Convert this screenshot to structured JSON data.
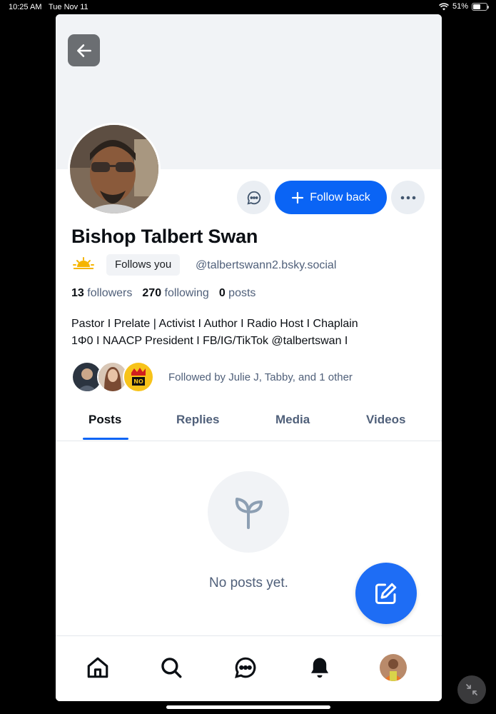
{
  "status_bar": {
    "time": "10:25 AM",
    "date": "Tue Nov 11",
    "battery": "51%"
  },
  "profile": {
    "display_name": "Bishop Talbert Swan",
    "follows_you": "Follows you",
    "handle": "@talbertswann2.bsky.social",
    "followers_count": "13",
    "followers_label": "followers",
    "following_count": "270",
    "following_label": "following",
    "posts_count": "0",
    "posts_label": "posts",
    "bio_line1": "Pastor I Prelate | Activist I Author I Radio Host I Chaplain",
    "bio_line2": "1Φ0 I NAACP President I FB/IG/TikTok @talbertswan I",
    "followed_by": "Followed by Julie J, Tabby, and 1 other"
  },
  "actions": {
    "follow_back": "Follow back"
  },
  "tabs": [
    {
      "label": "Posts",
      "active": true
    },
    {
      "label": "Replies",
      "active": false
    },
    {
      "label": "Media",
      "active": false
    },
    {
      "label": "Videos",
      "active": false
    }
  ],
  "empty_state": {
    "text": "No posts yet."
  },
  "colors": {
    "accent": "#0a64f5",
    "muted": "#50607a",
    "banner": "#f1f3f6"
  }
}
